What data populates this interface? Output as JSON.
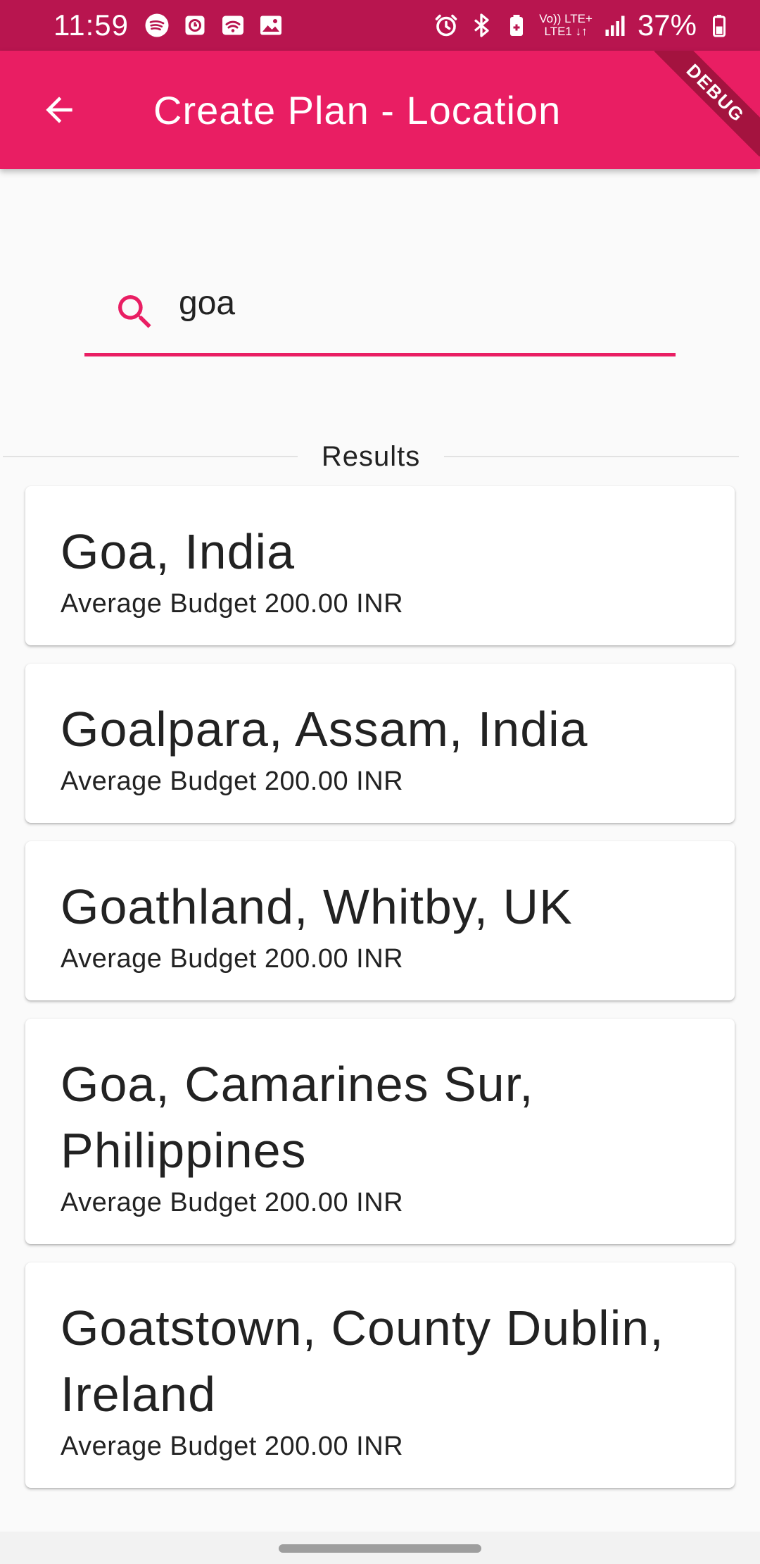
{
  "status_bar": {
    "time": "11:59",
    "left_icons": [
      "spotify-icon",
      "clock-app-icon",
      "wifi-calling-icon",
      "image-icon"
    ],
    "right_icons": [
      "alarm-icon",
      "bluetooth-icon",
      "battery-saver-icon",
      "signal-icon",
      "battery-icon"
    ],
    "network_line1": "Vo)) LTE+",
    "network_line2": "LTE1 ↓↑",
    "battery_percent": "37%"
  },
  "app_bar": {
    "title": "Create Plan - Location",
    "back_icon": "arrow-back-icon",
    "color": "#e91e63",
    "debug_label": "DEBUG"
  },
  "search": {
    "value": "goa",
    "icon": "search-icon",
    "accent": "#e91e63"
  },
  "results": {
    "label": "Results",
    "items": [
      {
        "name": "Goa, India",
        "budget": "Average Budget 200.00 INR"
      },
      {
        "name": "Goalpara, Assam, India",
        "budget": "Average Budget 200.00 INR"
      },
      {
        "name": "Goathland, Whitby, UK",
        "budget": "Average Budget 200.00 INR"
      },
      {
        "name": "Goa, Camarines Sur, Philippines",
        "budget": "Average Budget 200.00 INR"
      },
      {
        "name": "Goatstown, County Dublin, Ireland",
        "budget": "Average Budget 200.00 INR"
      }
    ]
  }
}
